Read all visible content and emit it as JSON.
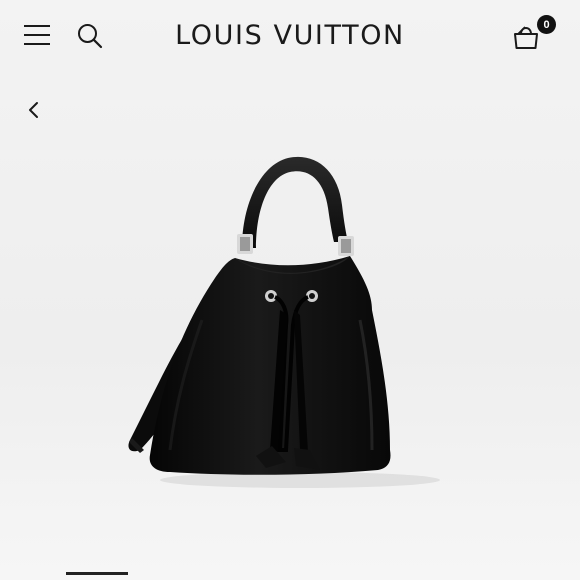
{
  "header": {
    "logo": "LOUIS VUITTON",
    "cart_count": "0",
    "menu_icon": "menu-icon",
    "search_icon": "search-icon",
    "cart_icon": "shopping-bag-icon"
  },
  "navigation": {
    "back_icon": "chevron-left-icon"
  },
  "product": {
    "image_icon": "handbag-image",
    "color": "#0b0b0b"
  }
}
